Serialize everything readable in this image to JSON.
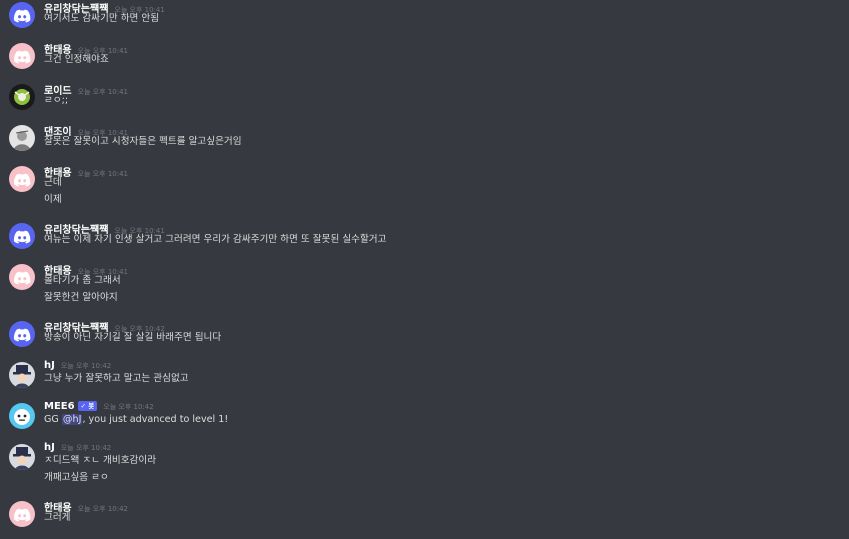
{
  "messages": [
    {
      "avatar": "discord-blue",
      "username": "유리창닦는쨱쨱",
      "timestamp": "오늘 오후 10:41",
      "lines": [
        "여기서도 감싸기만 하면 안됨"
      ]
    },
    {
      "avatar": "discord-pink",
      "username": "한태용",
      "timestamp": "오늘 오후 10:41",
      "lines": [
        "그건 인정해야죠"
      ]
    },
    {
      "avatar": "custom-dark",
      "username": "로이드",
      "timestamp": "오늘 오후 10:41",
      "lines": [
        "ㄹㅇ;;"
      ]
    },
    {
      "avatar": "custom-gray",
      "username": "댄조이",
      "timestamp": "오늘 오후 10:41",
      "lines": [
        "잘못은 잘못이고 시청자들은 펙트를 알고싶은거임"
      ]
    },
    {
      "avatar": "discord-pink",
      "username": "한태용",
      "timestamp": "오늘 오후 10:41",
      "lines": [
        "근데",
        "이제"
      ]
    },
    {
      "avatar": "discord-blue",
      "username": "유리창닦는쨱쨱",
      "timestamp": "오늘 오후 10:41",
      "lines": [
        "여뉴는 이제 자기 인생 살거고 그러려면 우리가 감싸주기만 하면 또 잘못된 실수할거고"
      ]
    },
    {
      "avatar": "discord-pink",
      "username": "한태용",
      "timestamp": "오늘 오후 10:41",
      "lines": [
        "몰타기가 좀 그래서",
        "잘못한건 알아야지"
      ]
    },
    {
      "avatar": "discord-blue",
      "username": "유리창닦는쨱쨱",
      "timestamp": "오늘 오후 10:42",
      "lines": [
        "방송이 아닌 자기길 잘 살길 바래주면 됩니다"
      ]
    },
    {
      "avatar": "custom-hat",
      "username": "hJ",
      "timestamp": "오늘 오후 10:42",
      "lines": [
        "그냥 누가 잘못하고 말고는 관심없고"
      ]
    },
    {
      "avatar": "mee6",
      "username": "MEE6",
      "badge": "✓ 봇",
      "timestamp": "오늘 오후 10:42",
      "lines": [
        "GG @hJ, you just advanced to level 1!"
      ],
      "mention": "@hJ"
    },
    {
      "avatar": "custom-hat",
      "username": "hJ",
      "timestamp": "오늘 오후 10:42",
      "lines": [
        "ㅈ디드왝 ㅈㄴ 개비호감이라",
        "개패고싶음 ㄹㅇ"
      ]
    },
    {
      "avatar": "discord-pink",
      "username": "한태용",
      "timestamp": "오늘 오후 10:42",
      "lines": [
        "그러게"
      ]
    }
  ],
  "colors": {
    "background": "#36393f",
    "username": "#ffffff",
    "text": "#dcddde",
    "timestamp": "#72767d",
    "blurple": "#5865f2",
    "pink": "#f8c0c8",
    "mee6": "#55c8f0"
  }
}
